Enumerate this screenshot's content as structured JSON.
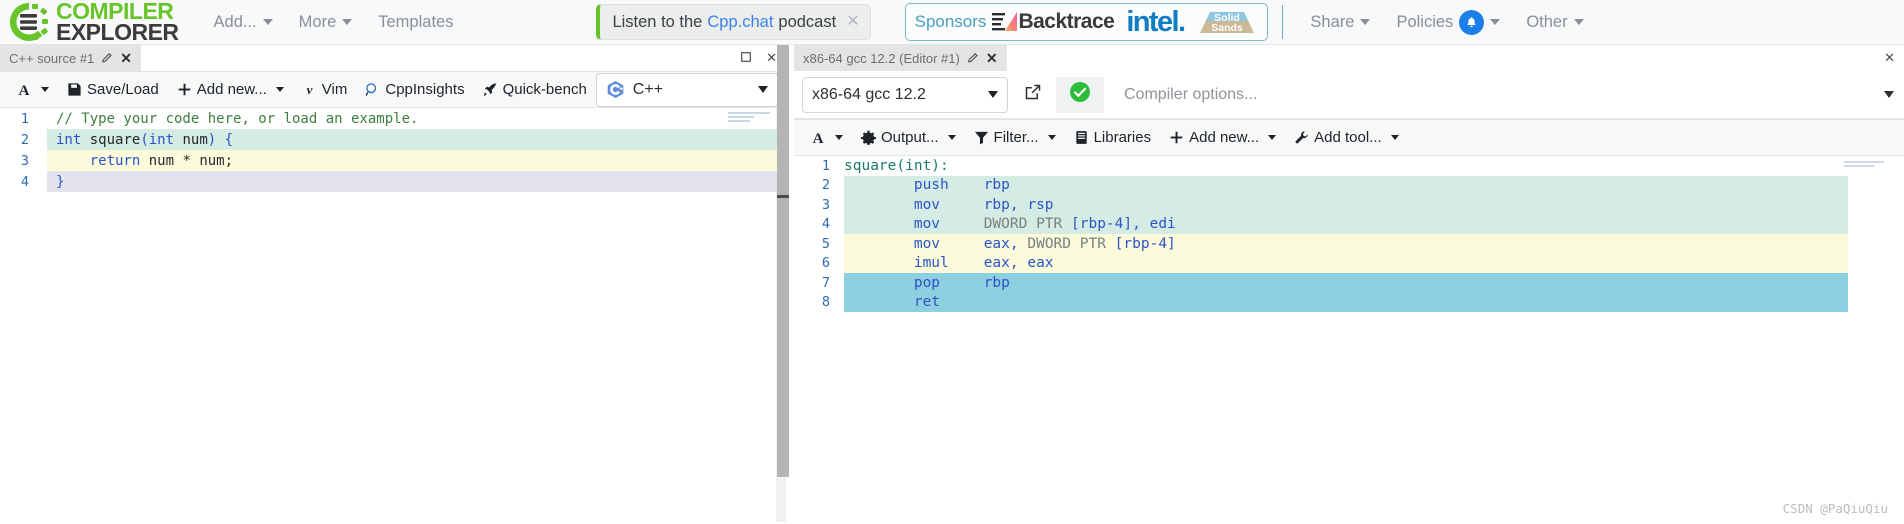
{
  "navbar": {
    "brand": {
      "line1": "COMPILER",
      "line2": "EXPLORER",
      "logo_icon": "compiler-explorer-gear-logo"
    },
    "items": [
      {
        "label": "Add...",
        "caret": true
      },
      {
        "label": "More",
        "caret": true
      },
      {
        "label": "Templates",
        "caret": false
      }
    ],
    "podcast": {
      "prefix": "Listen to the",
      "link": "Cpp.chat",
      "suffix": "podcast",
      "close_icon": "close-icon"
    },
    "sponsors": {
      "label": "Sponsors",
      "backtrace": "Backtrace",
      "intel": "intel.",
      "solid_sands_top": "Solid",
      "solid_sands_bottom": "Sands"
    },
    "right_items": [
      {
        "label": "Share",
        "caret": true,
        "bell": false
      },
      {
        "label": "Policies",
        "caret": true,
        "bell": true
      },
      {
        "label": "Other",
        "caret": true,
        "bell": false
      }
    ]
  },
  "editor_pane": {
    "tab": {
      "title": "C++ source #1",
      "edit_icon": "pencil-icon",
      "close_icon": "close-icon"
    },
    "pane_controls": {
      "maximize_icon": "maximize-icon",
      "close_icon": "close-icon"
    },
    "toolbar": [
      {
        "label": "A",
        "icon": "font-size-icon",
        "caret": true
      },
      {
        "label": "Save/Load",
        "icon": "save-icon",
        "caret": false
      },
      {
        "label": "Add new...",
        "icon": "plus-icon",
        "caret": true
      },
      {
        "label": "Vim",
        "icon": "vim-icon",
        "caret": false
      },
      {
        "label": "CppInsights",
        "icon": "magnifier-icon",
        "caret": false
      },
      {
        "label": "Quick-bench",
        "icon": "rocket-icon",
        "caret": false
      }
    ],
    "language": {
      "name": "C++",
      "icon": "cpp-logo-icon"
    },
    "code": {
      "lines": [
        {
          "num": "1",
          "highlight": "none",
          "tokens": [
            {
              "t": "// Type your code here, or load an example.",
              "c": "tok-comment"
            }
          ]
        },
        {
          "num": "2",
          "highlight": "mint",
          "tokens": [
            {
              "t": "int",
              "c": "tok-kw"
            },
            {
              "t": " square",
              "c": "tok-plain"
            },
            {
              "t": "(",
              "c": "tok-paren"
            },
            {
              "t": "int",
              "c": "tok-kw"
            },
            {
              "t": " num",
              "c": "tok-plain"
            },
            {
              "t": ")",
              "c": "tok-paren"
            },
            {
              "t": " ",
              "c": "tok-plain"
            },
            {
              "t": "{",
              "c": "tok-paren"
            }
          ]
        },
        {
          "num": "3",
          "highlight": "yellow",
          "tokens": [
            {
              "t": "    ",
              "c": "tok-plain"
            },
            {
              "t": "return",
              "c": "tok-kw"
            },
            {
              "t": " num ",
              "c": "tok-plain"
            },
            {
              "t": "*",
              "c": "tok-punct"
            },
            {
              "t": " num;",
              "c": "tok-plain"
            }
          ]
        },
        {
          "num": "4",
          "highlight": "lavender",
          "tokens": [
            {
              "t": "}",
              "c": "tok-paren"
            }
          ]
        }
      ]
    }
  },
  "compiler_pane": {
    "tab": {
      "title": "x86-64 gcc 12.2 (Editor #1)",
      "edit_icon": "pencil-icon",
      "close_icon": "close-icon"
    },
    "pane_controls": {
      "close_icon": "close-icon"
    },
    "compiler": {
      "name": "x86-64 gcc 12.2"
    },
    "popout_icon": "open-external-icon",
    "status_icon": "compile-success-icon",
    "options": {
      "value": "",
      "placeholder": "Compiler options..."
    },
    "toolbar": [
      {
        "label": "A",
        "icon": "font-size-icon",
        "caret": true
      },
      {
        "label": "Output...",
        "icon": "gear-icon",
        "caret": true
      },
      {
        "label": "Filter...",
        "icon": "funnel-icon",
        "caret": true
      },
      {
        "label": "Libraries",
        "icon": "book-icon",
        "caret": false
      },
      {
        "label": "Add new...",
        "icon": "plus-icon",
        "caret": true
      },
      {
        "label": "Add tool...",
        "icon": "wrench-icon",
        "caret": true
      }
    ],
    "asm": {
      "lines": [
        {
          "num": "1",
          "highlight": "none",
          "tokens": [
            {
              "t": "square(int):",
              "c": "asm-label"
            }
          ]
        },
        {
          "num": "2",
          "highlight": "mint",
          "tokens": [
            {
              "t": "        ",
              "c": "asm-dir"
            },
            {
              "t": "push",
              "c": "asm-op"
            },
            {
              "t": "    ",
              "c": "asm-dir"
            },
            {
              "t": "rbp",
              "c": "asm-reg"
            }
          ]
        },
        {
          "num": "3",
          "highlight": "mint",
          "tokens": [
            {
              "t": "        ",
              "c": "asm-dir"
            },
            {
              "t": "mov",
              "c": "asm-op"
            },
            {
              "t": "     ",
              "c": "asm-dir"
            },
            {
              "t": "rbp, rsp",
              "c": "asm-reg"
            }
          ]
        },
        {
          "num": "4",
          "highlight": "mint",
          "tokens": [
            {
              "t": "        ",
              "c": "asm-dir"
            },
            {
              "t": "mov",
              "c": "asm-op"
            },
            {
              "t": "     ",
              "c": "asm-dir"
            },
            {
              "t": "DWORD PTR ",
              "c": "asm-dir"
            },
            {
              "t": "[rbp-4]",
              "c": "asm-mem"
            },
            {
              "t": ", edi",
              "c": "asm-reg"
            }
          ]
        },
        {
          "num": "5",
          "highlight": "yellow",
          "tokens": [
            {
              "t": "        ",
              "c": "asm-dir"
            },
            {
              "t": "mov",
              "c": "asm-op"
            },
            {
              "t": "     ",
              "c": "asm-dir"
            },
            {
              "t": "eax, ",
              "c": "asm-reg"
            },
            {
              "t": "DWORD PTR ",
              "c": "asm-dir"
            },
            {
              "t": "[rbp-4]",
              "c": "asm-mem"
            }
          ]
        },
        {
          "num": "6",
          "highlight": "yellow",
          "tokens": [
            {
              "t": "        ",
              "c": "asm-dir"
            },
            {
              "t": "imul",
              "c": "asm-op"
            },
            {
              "t": "    ",
              "c": "asm-dir"
            },
            {
              "t": "eax, eax",
              "c": "asm-reg"
            }
          ]
        },
        {
          "num": "7",
          "highlight": "blue",
          "tokens": [
            {
              "t": "        ",
              "c": "asm-dir"
            },
            {
              "t": "pop",
              "c": "asm-op"
            },
            {
              "t": "     ",
              "c": "asm-dir"
            },
            {
              "t": "rbp",
              "c": "asm-reg"
            }
          ]
        },
        {
          "num": "8",
          "highlight": "blue",
          "tokens": [
            {
              "t": "        ",
              "c": "asm-dir"
            },
            {
              "t": "ret",
              "c": "asm-op"
            }
          ]
        }
      ]
    }
  },
  "watermark": "CSDN @PaQiuQiu",
  "colors": {
    "brand_green": "#67c52a",
    "link_blue": "#3b82e8",
    "highlight_mint": "#d4ece3",
    "highlight_yellow": "#fbfbdc",
    "highlight_lavender": "#e3e3f0",
    "highlight_blue": "#8fd0e0",
    "success_green": "#2dbd3a"
  }
}
